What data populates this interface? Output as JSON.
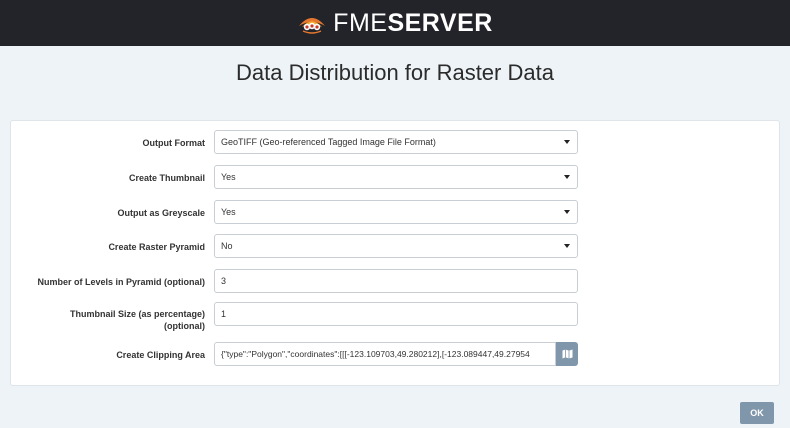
{
  "header": {
    "brand_fme": "FME",
    "brand_server": "SERVER",
    "logo_icon": "fme-logo-icon",
    "background": "#222429"
  },
  "page": {
    "title": "Data Distribution for Raster Data"
  },
  "form": {
    "output_format": {
      "label": "Output Format",
      "value": "GeoTIFF (Geo-referenced Tagged Image File Format)"
    },
    "create_thumbnail": {
      "label": "Create Thumbnail",
      "value": "Yes"
    },
    "output_greyscale": {
      "label": "Output as Greyscale",
      "value": "Yes"
    },
    "create_pyramid": {
      "label": "Create Raster Pyramid",
      "value": "No"
    },
    "pyramid_levels": {
      "label": "Number of Levels in Pyramid (optional)",
      "value": "3"
    },
    "thumbnail_size": {
      "label_line1": "Thumbnail Size (as percentage)",
      "label_line2": "(optional)",
      "value": "1"
    },
    "clipping_area": {
      "label": "Create Clipping Area",
      "value": "{\"type\":\"Polygon\",\"coordinates\":[[[-123.109703,49.280212],[-123.089447,49.27954",
      "button_icon": "map-icon"
    }
  },
  "footer": {
    "ok_label": "OK",
    "accent": "#8096aa"
  }
}
